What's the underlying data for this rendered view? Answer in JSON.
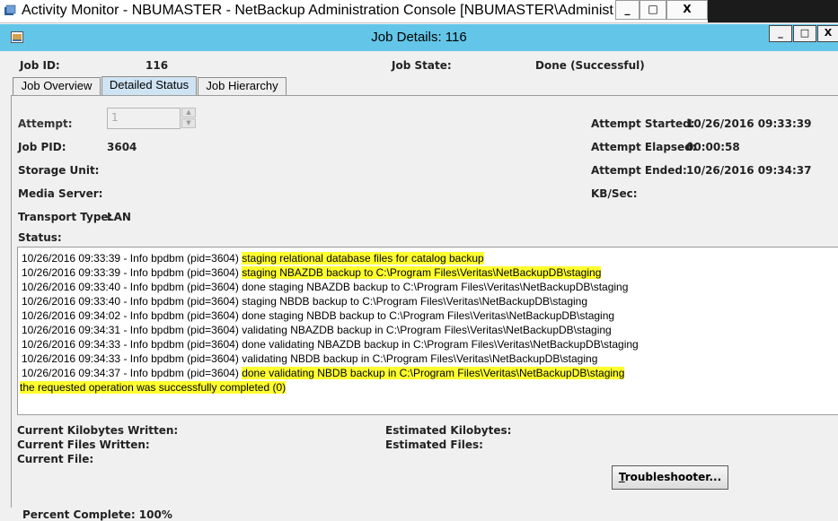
{
  "outer_window": {
    "title": "Activity Monitor - NBUMASTER - NetBackup Administration Console [NBUMASTER\\Administrator l",
    "minimize": "_",
    "maximize": "□",
    "close": "X"
  },
  "dialog": {
    "title": "Job Details: 116",
    "minimize": "_",
    "maximize": "□",
    "close": "X"
  },
  "job_header": {
    "job_id_label": "Job ID:",
    "job_id_value": "116",
    "job_state_label": "Job State:",
    "job_state_value": "Done (Successful)"
  },
  "tabs": [
    "Job Overview",
    "Detailed Status",
    "Job Hierarchy"
  ],
  "active_tab": "Detailed Status",
  "details": {
    "attempt_label": "Attempt:",
    "attempt_value": "1",
    "job_pid_label": "Job PID:",
    "job_pid_value": "3604",
    "storage_unit_label": "Storage Unit:",
    "media_server_label": "Media Server:",
    "transport_type_label": "Transport Type:",
    "transport_type_value": "LAN",
    "attempt_started_label": "Attempt Started:",
    "attempt_started_value": "10/26/2016 09:33:39",
    "attempt_elapsed_label": "Attempt Elapsed:",
    "attempt_elapsed_value": "00:00:58",
    "attempt_ended_label": "Attempt Ended:",
    "attempt_ended_value": "10/26/2016 09:34:37",
    "kb_sec_label": "KB/Sec:"
  },
  "status": {
    "label": "Status:",
    "lines": [
      {
        "prefix": "10/26/2016 09:33:39 - Info bpdbm (pid=3604) ",
        "text": "staging relational database files for catalog backup",
        "highlight": true
      },
      {
        "prefix": "10/26/2016 09:33:39 - Info bpdbm (pid=3604) ",
        "text": "staging NBAZDB backup to C:\\Program Files\\Veritas\\NetBackupDB\\staging",
        "highlight": true
      },
      {
        "prefix": "10/26/2016 09:33:40 - Info bpdbm (pid=3604) ",
        "text": "done staging NBAZDB backup to C:\\Program Files\\Veritas\\NetBackupDB\\staging",
        "highlight": false
      },
      {
        "prefix": "10/26/2016 09:33:40 - Info bpdbm (pid=3604) ",
        "text": "staging NBDB backup to C:\\Program Files\\Veritas\\NetBackupDB\\staging",
        "highlight": false
      },
      {
        "prefix": "10/26/2016 09:34:02 - Info bpdbm (pid=3604) ",
        "text": "done staging NBDB backup to C:\\Program Files\\Veritas\\NetBackupDB\\staging",
        "highlight": false
      },
      {
        "prefix": "10/26/2016 09:34:31 - Info bpdbm (pid=3604) ",
        "text": "validating NBAZDB backup in C:\\Program Files\\Veritas\\NetBackupDB\\staging",
        "highlight": false
      },
      {
        "prefix": "10/26/2016 09:34:33 - Info bpdbm (pid=3604) ",
        "text": "done validating NBAZDB backup in C:\\Program Files\\Veritas\\NetBackupDB\\staging",
        "highlight": false
      },
      {
        "prefix": "10/26/2016 09:34:33 - Info bpdbm (pid=3604) ",
        "text": "validating NBDB backup in C:\\Program Files\\Veritas\\NetBackupDB\\staging",
        "highlight": false
      },
      {
        "prefix": "10/26/2016 09:34:37 - Info bpdbm (pid=3604) ",
        "text": "done validating NBDB backup in C:\\Program Files\\Veritas\\NetBackupDB\\staging",
        "highlight": true
      },
      {
        "prefix": "",
        "text": "the requested operation was successfully completed  (0)",
        "highlight": true
      }
    ]
  },
  "progress": {
    "current_kb_written_label": "Current Kilobytes Written:",
    "current_files_written_label": "Current Files Written:",
    "current_file_label": "Current File:",
    "estimated_kb_label": "Estimated Kilobytes:",
    "estimated_files_label": "Estimated Files:",
    "percent_complete_label": "Percent Complete: 100%"
  },
  "troubleshooter_button": {
    "accel": "T",
    "rest": "roubleshooter..."
  },
  "colors": {
    "dialog_title_bg": "#63c6e8",
    "highlight": "#ffff2e",
    "active_tab_bg": "#cfe3f3"
  }
}
